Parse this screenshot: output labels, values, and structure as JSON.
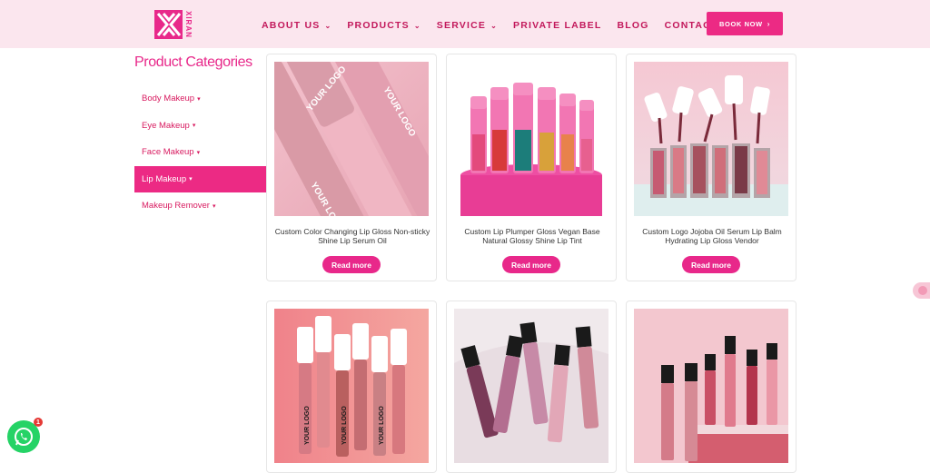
{
  "header": {
    "logo_text": "XIRAN",
    "nav": [
      {
        "label": "ABOUT US",
        "has_dropdown": true
      },
      {
        "label": "PRODUCTS",
        "has_dropdown": true
      },
      {
        "label": "SERVICE",
        "has_dropdown": true
      },
      {
        "label": "PRIVATE LABEL",
        "has_dropdown": false
      },
      {
        "label": "BLOG",
        "has_dropdown": false
      },
      {
        "label": "CONTACT US",
        "has_dropdown": false
      }
    ],
    "book_now": "BOOK NOW"
  },
  "sidebar": {
    "title": "Product Categories",
    "items": [
      {
        "label": "Body Makeup",
        "active": false
      },
      {
        "label": "Eye Makeup",
        "active": false
      },
      {
        "label": "Face Makeup",
        "active": false
      },
      {
        "label": "Lip Makeup",
        "active": true
      },
      {
        "label": "Makeup Remover",
        "active": false
      }
    ]
  },
  "products": [
    {
      "title": "Custom Color Changing Lip Gloss Non-sticky Shine Lip Serum Oil",
      "button": "Read more"
    },
    {
      "title": "Custom Lip Plumper Gloss Vegan Base Natural Glossy Shine Lip Tint",
      "button": "Read more"
    },
    {
      "title": "Custom Logo Jojoba Oil Serum Lip Balm Hydrating Lip Gloss Vendor",
      "button": "Read more"
    },
    {
      "title": "",
      "button": ""
    },
    {
      "title": "",
      "button": ""
    },
    {
      "title": "",
      "button": ""
    }
  ],
  "product_image_text": {
    "logo_print": "YOUR LOGO"
  },
  "whatsapp": {
    "badge": "1"
  },
  "colors": {
    "brand_pink": "#e8288a",
    "header_bg": "#fbe6ee",
    "active_bg": "#ec2a84"
  }
}
